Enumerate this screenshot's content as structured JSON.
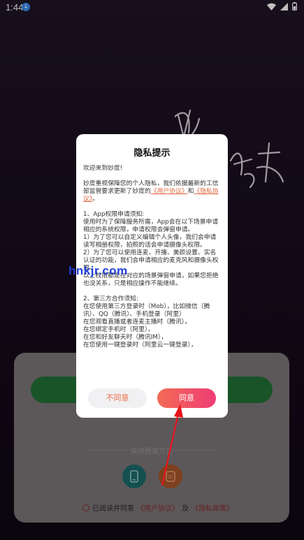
{
  "status_bar": {
    "time": "1:44",
    "download_icon": "download-icon",
    "icons": [
      "wifi-icon",
      "signal-icon",
      "battery-icon"
    ]
  },
  "background": {
    "logo_icon": "miaodu-logo-icon"
  },
  "login": {
    "other_login_label": "其他登录方式",
    "icons": [
      "phone-icon",
      "id-icon"
    ],
    "agree_prefix": "已阅读并同意",
    "user_agreement": "《用户协议》",
    "and": "及",
    "privacy_policy": "《隐私政策》"
  },
  "dialog": {
    "title": "隐私提示",
    "greeting": "欢迎来到妙度!",
    "intro_1": "妙度重视保障您的个人隐私，我们依据最新的工信部监管要求更新了妙度的",
    "user_agreement_link": "《用户协议》",
    "intro_and": "和",
    "privacy_link": "《隐私协议》",
    "intro_end": "。",
    "section1_title": "1、App权限申请须知:",
    "section1_text": "使用时为了保障服务所需，App会在以下场景申请相应的系统权限，申请权限会弹窗申请。",
    "item1": "1）为了您可以自定义编辑个人头像，我们会申请读写相册权限，拍照的话会申请摄像头权限。",
    "item2": "2）为了您可以使用连麦、开播、美颜设置、实名认证的功能，我们会申请相应的麦克风和摄像头权限。",
    "section1_end": "以上权限都是在对应的场景弹窗申请，如果您拒绝也没关系，只是相应操作不能继续。",
    "section2_title": "2、第三方合作须知:",
    "section2_line1": "在您使用第三方登录时（Mob），比如微信（腾讯）、QQ（腾讯）、手机登录（阿里）",
    "section2_line2": "在您观看直播或者连麦主播时（腾讯），",
    "section2_line3": "在您绑定手机时（阿里），",
    "section2_line4": "在您和好友聊天时（腾讯IM），",
    "section2_line5": "在您使用一键登录时（阿里云一键登录），",
    "reject_label": "不同意",
    "agree_label": "同意"
  },
  "watermark": "hnkjr.com",
  "colors": {
    "accent_orange": "#ee6a45",
    "agree_gradient_start": "#f36b55",
    "agree_gradient_end": "#ee3d75",
    "link_orange": "#e0683e",
    "arrow_red": "#e8141c",
    "watermark_blue": "#1f3fd8"
  }
}
